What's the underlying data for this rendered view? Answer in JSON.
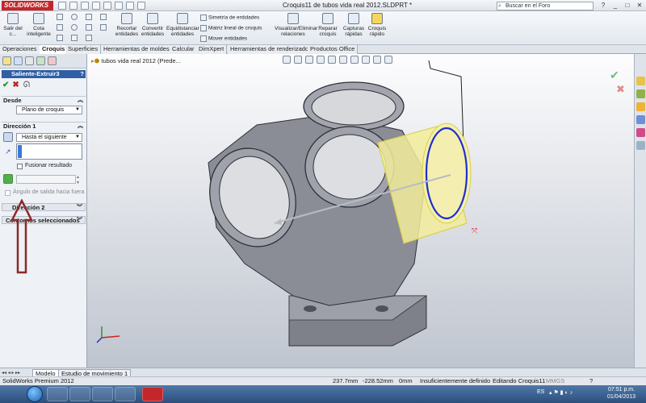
{
  "app": {
    "logo": "SOLIDWORKS",
    "document_title": "Croquis11 de tubos vida real 2012.SLDPRT *",
    "search_placeholder": "Buscar en el Foro",
    "window_controls": [
      "?",
      "_",
      "□",
      "✕"
    ]
  },
  "ribbon": {
    "buttons": [
      {
        "label": "Salir del c...",
        "icon": "exit-sketch-icon"
      },
      {
        "label": "Cota inteligente",
        "icon": "smart-dimension-icon"
      },
      {
        "label": "Recortar entidades",
        "icon": "trim-icon"
      },
      {
        "label": "Convertir entidades",
        "icon": "convert-icon"
      },
      {
        "label": "Equidistanciar entidades",
        "icon": "offset-icon"
      },
      {
        "label": "Visualizar/Eliminar relaciones",
        "icon": "relations-icon"
      },
      {
        "label": "Reparar croquis",
        "icon": "repair-icon"
      },
      {
        "label": "Capturas rápidas",
        "icon": "snaps-icon"
      },
      {
        "label": "Croquis rápido",
        "icon": "rapid-sketch-icon"
      }
    ],
    "small_items": [
      "Simetría de entidades",
      "Matriz lineal de croquis",
      "Mover entidades"
    ]
  },
  "command_tabs": [
    "Operaciones",
    "Croquis",
    "Superficies",
    "Herramientas de moldes",
    "Calcular",
    "DimXpert",
    "Herramientas de renderizado",
    "Productos Office"
  ],
  "active_tab": "Croquis",
  "property_manager": {
    "feature_title": "Saliente-Extruir3",
    "help": "?",
    "ok_symbol": "✔",
    "cancel_symbol": "✖",
    "section_desde": {
      "title": "Desde",
      "value": "Plano de croquis"
    },
    "section_direccion1": {
      "title": "Dirección 1",
      "end_condition": "Hasta el siguiente",
      "merge_label": "Fusionar resultado",
      "draft_label": "Ángulo de salida hacia fuera"
    },
    "section_direccion2": {
      "title": "Dirección 2"
    },
    "section_contornos": {
      "title": "Contornos seleccionados"
    }
  },
  "viewport": {
    "tree_label": "tubos vida real 2012  (Prede..."
  },
  "bottom_tabs": [
    "Modelo",
    "Estudio de movimiento 1"
  ],
  "active_bottom_tab": "Modelo",
  "status": {
    "product": "SolidWorks Premium 2012",
    "x": "237.7mm",
    "y": "-228.52mm",
    "z": "0mm",
    "state": "Insuficientemente definido",
    "editing": "Editando Croquis11",
    "units": "MMGS"
  },
  "taskbar": {
    "lang": "ES",
    "time": "07:51 p.m.",
    "date": "01/04/2013"
  },
  "colors": {
    "accent_blue": "#2f5ea6",
    "ok_green": "#1c9b2c",
    "cancel_red": "#c2221f",
    "model_gray": "#8a8d96",
    "preview_yellow": "#f2ec9a",
    "arrow_maroon": "#8b2a2a",
    "logo_red": "#c3272b"
  }
}
